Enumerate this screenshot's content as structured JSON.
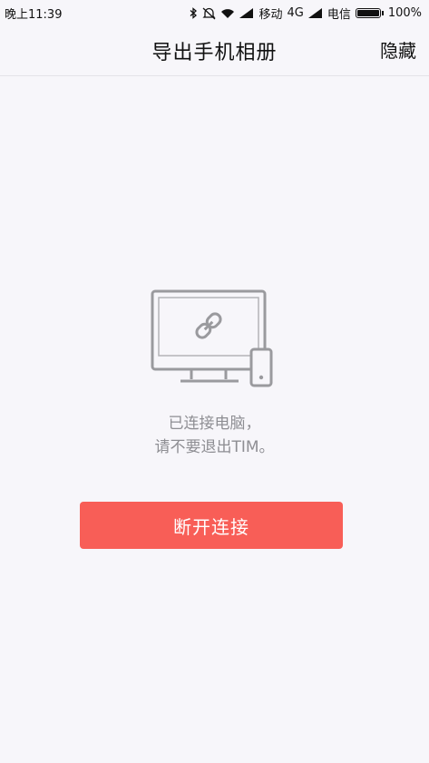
{
  "status_bar": {
    "time": "晚上11:39",
    "carrier1": "移动",
    "network": "4G",
    "carrier2": "电信",
    "battery": "100%"
  },
  "nav": {
    "title": "导出手机相册",
    "hide_label": "隐藏"
  },
  "main": {
    "message_line1": "已连接电脑，",
    "message_line2": "请不要退出TIM。",
    "disconnect_label": "断开连接",
    "accent_color": "#f85e57"
  },
  "icons": [
    "bluetooth-icon",
    "mute-icon",
    "wifi-icon",
    "signal-icon",
    "battery-icon",
    "computer-link-icon",
    "phone-icon",
    "link-icon"
  ]
}
